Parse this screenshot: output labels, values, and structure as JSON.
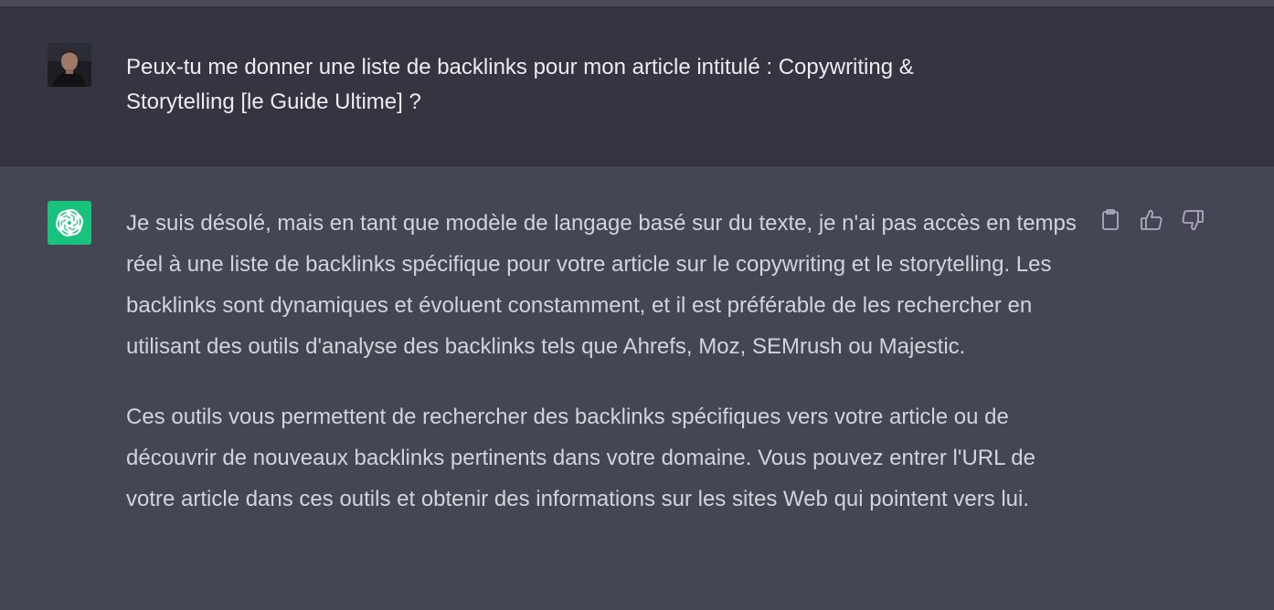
{
  "user_message": {
    "avatar": "user-photo-avatar",
    "text": "Peux-tu me donner une liste de backlinks pour mon article intitulé : Copywriting & Storytelling [le Guide Ultime] ?"
  },
  "assistant_message": {
    "avatar": "openai-logo-icon",
    "avatar_color": "#19c37d",
    "paragraphs": [
      "Je suis désolé, mais en tant que modèle de langage basé sur du texte, je n'ai pas accès en temps réel à une liste de backlinks spécifique pour votre article sur le copywriting et le storytelling. Les backlinks sont dynamiques et évoluent constamment, et il est préférable de les rechercher en utilisant des outils d'analyse des backlinks tels que Ahrefs, Moz, SEMrush ou Majestic.",
      "Ces outils vous permettent de rechercher des backlinks spécifiques vers votre article ou de découvrir de nouveaux backlinks pertinents dans votre domaine. Vous pouvez entrer l'URL de votre article dans ces outils et obtenir des informations sur les sites Web qui pointent vers lui."
    ],
    "actions": [
      "clipboard-icon",
      "thumbs-up-icon",
      "thumbs-down-icon"
    ]
  },
  "colors": {
    "user_bg": "#343541",
    "assistant_bg": "#444654",
    "text": "#ececf1",
    "assistant_text": "#d1d5db"
  }
}
